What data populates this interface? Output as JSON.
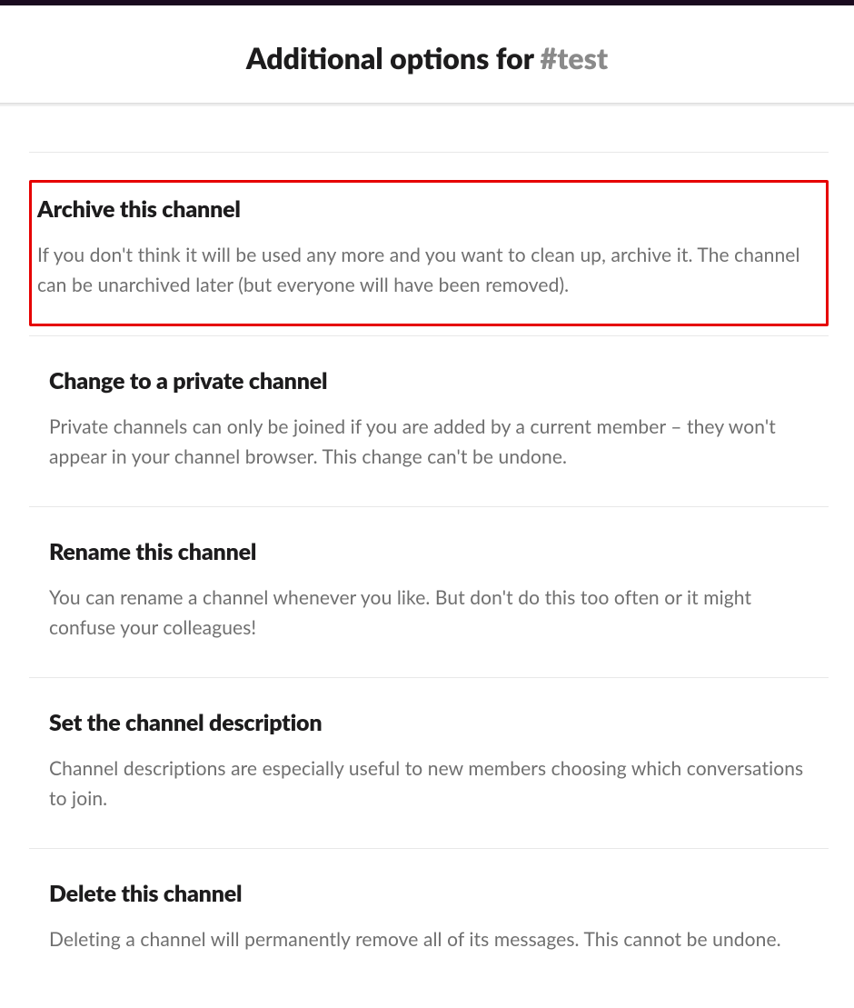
{
  "header": {
    "title_prefix": "Additional options for ",
    "channel_name": "#test"
  },
  "options": [
    {
      "title": "Archive this channel",
      "desc": "If you don't think it will be used any more and you want to clean up, archive it. The channel can be unarchived later (but everyone will have been removed).",
      "highlighted": true
    },
    {
      "title": "Change to a private channel",
      "desc": "Private channels can only be joined if you are added by a current member – they won't appear in your channel browser. This change can't be undone.",
      "highlighted": false
    },
    {
      "title": "Rename this channel",
      "desc": "You can rename a channel whenever you like. But don't do this too often or it might confuse your colleagues!",
      "highlighted": false
    },
    {
      "title": "Set the channel description",
      "desc": "Channel descriptions are especially useful to new members choosing which conversations to join.",
      "highlighted": false
    },
    {
      "title": "Delete this channel",
      "desc": "Deleting a channel will permanently remove all of its messages. This cannot be undone.",
      "highlighted": false
    }
  ]
}
